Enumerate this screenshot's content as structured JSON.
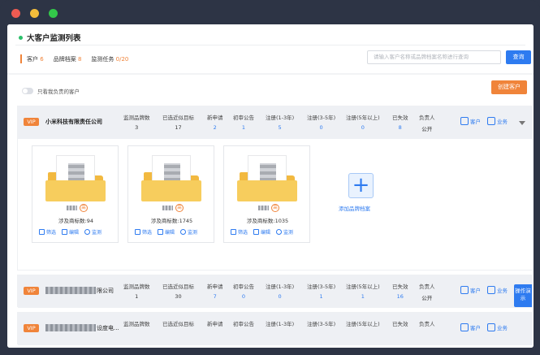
{
  "window": {
    "dots": [
      "#ee5b52",
      "#f4bd3b",
      "#33c84a"
    ]
  },
  "header": {
    "title": "大客户监测列表",
    "stats": [
      {
        "label": "客户",
        "value": "6"
      },
      {
        "label": "品牌档案",
        "value": "8"
      },
      {
        "label": "监测任务",
        "value": "0/20"
      }
    ],
    "search_placeholder": "请输入客户名称或品牌档案名称进行查询",
    "search_button": "查询"
  },
  "toolbar": {
    "toggle_label": "只看我负责的客户",
    "create_button": "创建客户"
  },
  "columns": [
    "监测品牌数",
    "已选近似目标",
    "新申请",
    "初审公告",
    "注册(1-3年)",
    "注册(3-5年)",
    "注册(5年以上)",
    "已失效",
    "负责人"
  ],
  "actions": {
    "customer": "客户",
    "business": "业务"
  },
  "clients": [
    {
      "vip": "VIP",
      "name": "小米科技有限责任公司",
      "suffix": "",
      "values": [
        "3",
        "17",
        "2",
        "1",
        "5",
        "0",
        "0",
        "8",
        "公开"
      ]
    },
    {
      "vip": "VIP",
      "name": "",
      "suffix": "限公司",
      "values": [
        "1",
        "30",
        "7",
        "0",
        "0",
        "1",
        "1",
        "16",
        "公开"
      ]
    },
    {
      "vip": "VIP",
      "name": "",
      "suffix": "设度电...",
      "values": [
        "",
        "",
        "",
        "",
        "",
        "",
        "",
        "",
        ""
      ]
    }
  ],
  "brand_cards": [
    {
      "level": "高",
      "trademarks": "涉及商标数:94"
    },
    {
      "level": "高",
      "trademarks": "涉及商标数:1745"
    },
    {
      "level": "高",
      "trademarks": "涉及商标数:1035"
    }
  ],
  "card_ops": {
    "filter": "筛选",
    "edit": "编辑",
    "monitor": "监测"
  },
  "add_brand_label": "添加品牌档案",
  "side_help": "操作演示",
  "colors": {
    "accent": "#2e7bf0",
    "orange": "#f0843a"
  }
}
